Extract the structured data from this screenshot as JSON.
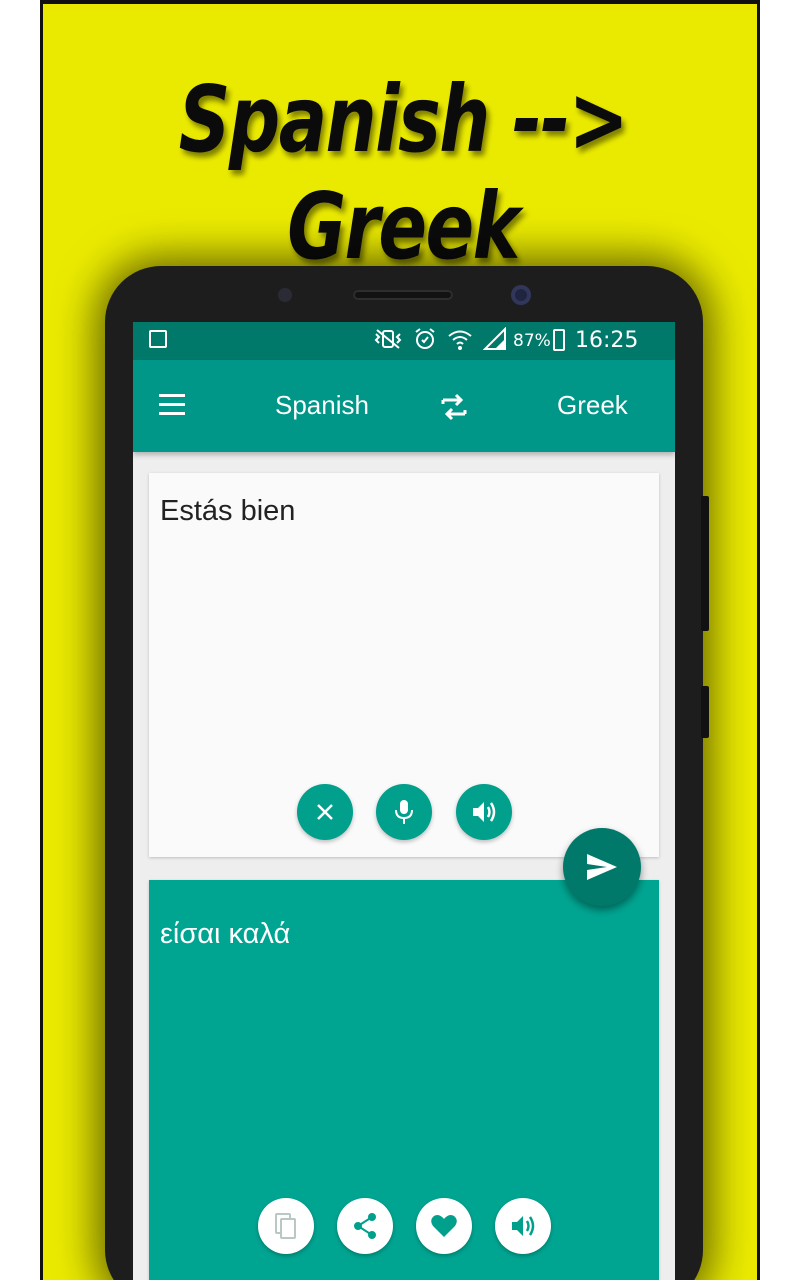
{
  "promo": {
    "headline": "Spanish --> Greek",
    "background_color": "#eaea00"
  },
  "statusbar": {
    "battery": "87%",
    "time": "16:25",
    "icons": [
      "gallery-icon",
      "vibrate-off-icon",
      "alarm-icon",
      "wifi-icon",
      "signal-icon",
      "battery-charging-icon"
    ]
  },
  "toolbar": {
    "source_language": "Spanish",
    "target_language": "Greek",
    "menu_icon": "menu-icon",
    "swap_icon": "swap-icon"
  },
  "input_card": {
    "text": "Estás bien",
    "buttons": [
      "clear-icon",
      "mic-icon",
      "speaker-icon"
    ]
  },
  "output_card": {
    "text": "είσαι καλά",
    "buttons": [
      "copy-icon",
      "share-icon",
      "favorite-icon",
      "speaker-icon"
    ]
  },
  "fab": {
    "icon": "send-icon"
  },
  "colors": {
    "primary": "#009688",
    "primary_dark": "#00796b",
    "output_bg": "#00a591"
  }
}
